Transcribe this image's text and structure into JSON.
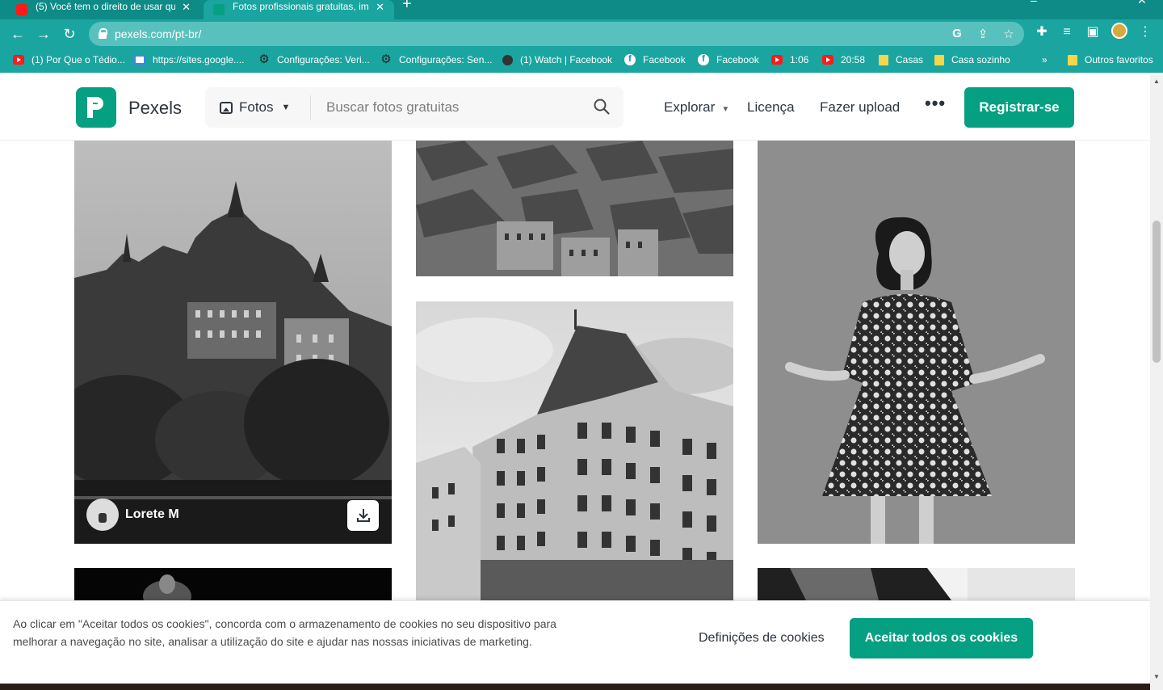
{
  "browser": {
    "tabs": [
      {
        "title": "(5) Você tem o direito de usar qu",
        "favicon": "youtube-icon",
        "active": false
      },
      {
        "title": "Fotos profissionais gratuitas, ima",
        "favicon": "pexels-icon",
        "active": true
      }
    ],
    "url": "pexels.com/pt-br/",
    "bookmarks": [
      {
        "label": "(1) Por Que o Tédio...",
        "icon": "youtube-icon"
      },
      {
        "label": "https://sites.google....",
        "icon": "google-sites-icon"
      },
      {
        "label": "Configurações: Veri...",
        "icon": "gear-icon"
      },
      {
        "label": "Configurações: Sen...",
        "icon": "gear-icon"
      },
      {
        "label": "(1) Watch | Facebook",
        "icon": "globe-icon"
      },
      {
        "label": "Facebook",
        "icon": "facebook-icon"
      },
      {
        "label": "Facebook",
        "icon": "facebook-icon"
      },
      {
        "label": "1:06",
        "icon": "youtube-icon"
      },
      {
        "label": "20:58",
        "icon": "youtube-icon"
      },
      {
        "label": "Casas",
        "icon": "folder-icon"
      },
      {
        "label": "Casa sozinho",
        "icon": "folder-icon"
      }
    ],
    "bookmarks_more": "»",
    "other_bookmarks": "Outros favoritos"
  },
  "header": {
    "brand": "Pexels",
    "search": {
      "type_label": "Fotos",
      "placeholder": "Buscar fotos gratuitas"
    },
    "nav": {
      "explore": "Explorar",
      "license": "Licença",
      "upload": "Fazer upload",
      "more": "•••"
    },
    "register": "Registrar-se"
  },
  "grid": {
    "photos": [
      {
        "subject": "castle-city",
        "author": "Lorete M",
        "show_overlay": true
      },
      {
        "subject": "rooftops"
      },
      {
        "subject": "woman-dress"
      },
      {
        "subject": "building"
      },
      {
        "subject": "dark-hand"
      },
      {
        "subject": "window-frame"
      }
    ]
  },
  "cookie": {
    "text": "Ao clicar em \"Aceitar todos os cookies\", concorda com o armazenamento de cookies no seu dispositivo para melhorar a navegação no site, analisar a utilização do site e ajudar nas nossas iniciativas de marketing.",
    "settings": "Definições de cookies",
    "accept": "Aceitar todos os cookies"
  },
  "colors": {
    "brand": "#05a081",
    "browser_frame": "#1aa5a0",
    "text_dark": "#2c343e"
  }
}
